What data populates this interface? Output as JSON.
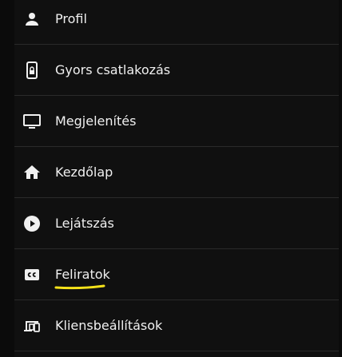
{
  "colors": {
    "background": "#101010",
    "text": "#f0f0f0",
    "divider": "#2a2a2a",
    "highlight": "#f5e21a"
  },
  "menu": {
    "items": [
      {
        "label": "Profil",
        "icon": "person-icon"
      },
      {
        "label": "Gyors csatlakozás",
        "icon": "phone-lock-icon"
      },
      {
        "label": "Megjelenítés",
        "icon": "monitor-icon"
      },
      {
        "label": "Kezdőlap",
        "icon": "home-icon"
      },
      {
        "label": "Lejátszás",
        "icon": "play-circle-icon"
      },
      {
        "label": "Feliratok",
        "icon": "closed-captions-icon",
        "highlighted": true
      },
      {
        "label": "Kliensbeállítások",
        "icon": "devices-icon"
      }
    ]
  }
}
